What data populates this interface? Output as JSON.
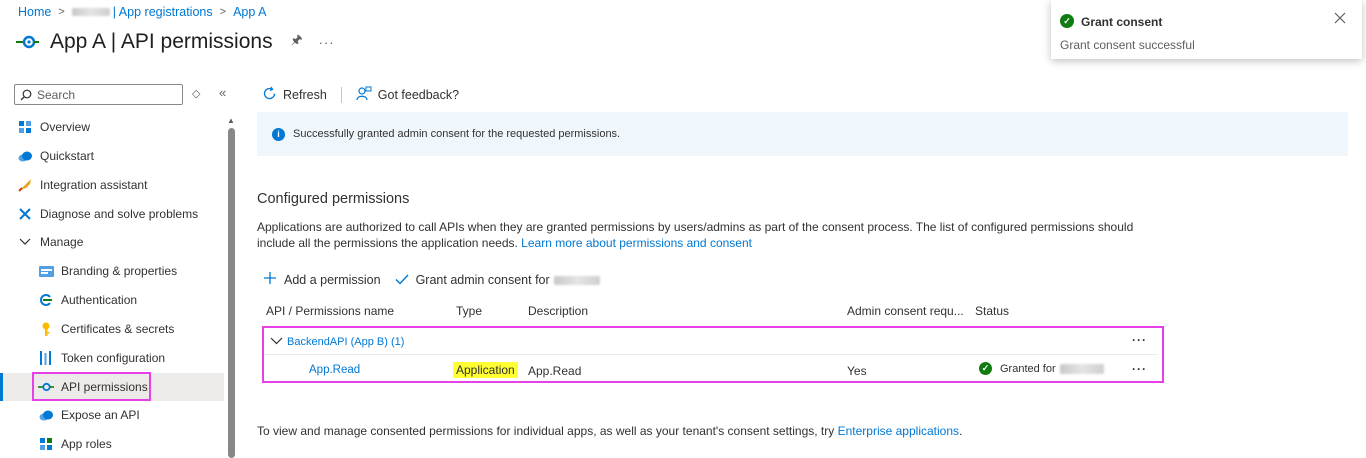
{
  "breadcrumb": {
    "home": "Home",
    "app_registrations": "| App registrations",
    "app": "App A"
  },
  "header": {
    "app_name": "App A",
    "page_name": "| API permissions"
  },
  "sidebar": {
    "search_placeholder": "Search",
    "items": [
      {
        "label": "Overview",
        "icon": "overview-grid-icon"
      },
      {
        "label": "Quickstart",
        "icon": "cloud-icon"
      },
      {
        "label": "Integration assistant",
        "icon": "rocket-icon"
      },
      {
        "label": "Diagnose and solve problems",
        "icon": "wrench-icon"
      },
      {
        "label": "Manage",
        "icon": "chevron-down-icon"
      },
      {
        "label": "Branding & properties",
        "icon": "branding-icon"
      },
      {
        "label": "Authentication",
        "icon": "authentication-icon"
      },
      {
        "label": "Certificates & secrets",
        "icon": "key-icon"
      },
      {
        "label": "Token configuration",
        "icon": "token-bars-icon"
      },
      {
        "label": "API permissions",
        "icon": "api-permissions-icon",
        "active": true
      },
      {
        "label": "Expose an API",
        "icon": "cloud-icon"
      },
      {
        "label": "App roles",
        "icon": "app-roles-grid-icon"
      }
    ]
  },
  "toolbar": {
    "refresh": "Refresh",
    "feedback": "Got feedback?"
  },
  "info_bar": {
    "message": "Successfully granted admin consent for the requested permissions."
  },
  "section": {
    "title": "Configured permissions",
    "description": "Applications are authorized to call APIs when they are granted permissions by users/admins as part of the consent process. The list of configured permissions should include all the permissions the application needs.",
    "learn_more": "Learn more about permissions and consent"
  },
  "commands": {
    "add_permission": "Add a permission",
    "grant_consent": "Grant admin consent for"
  },
  "table": {
    "headers": [
      "API / Permissions name",
      "Type",
      "Description",
      "Admin consent requ...",
      "Status"
    ],
    "group": {
      "label": "BackendAPI (App B) (1)"
    },
    "rows": [
      {
        "name": "App.Read",
        "type": "Application",
        "description": "App.Read",
        "admin_consent": "Yes",
        "status": "Granted for"
      }
    ]
  },
  "footer": {
    "text": "To view and manage consented permissions for individual apps, as well as your tenant's consent settings, try",
    "link": "Enterprise applications",
    "period": "."
  },
  "toast": {
    "title": "Grant consent",
    "message": "Grant consent successful"
  },
  "colors": {
    "accent": "#0078d4",
    "success": "#107c10",
    "highlight_border": "#e640e6",
    "type_highlight": "#ffff33"
  }
}
